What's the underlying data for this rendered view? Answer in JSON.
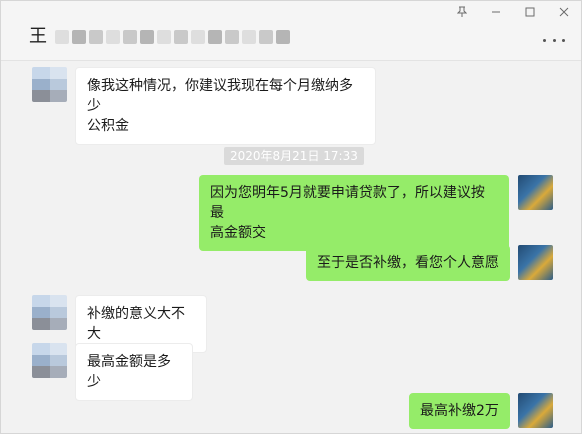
{
  "header": {
    "title_char": "王",
    "window_controls": [
      "pin-icon",
      "minimize-icon",
      "maximize-icon",
      "close-icon"
    ],
    "more_icon": "more-dots-icon"
  },
  "colors": {
    "self_bubble": "#95ec69",
    "other_bubble": "#ffffff",
    "background": "#f2f2f2",
    "timestamp_bg": "#dadada"
  },
  "messages": [
    {
      "from": "other",
      "text": "像我这种情况，你建议我现在每个月缴纳多少\n公积金"
    },
    {
      "type": "timestamp",
      "text": "2020年8月21日 17:33"
    },
    {
      "from": "self",
      "text": "因为您明年5月就要申请贷款了，所以建议按最\n高金额交"
    },
    {
      "from": "self",
      "text": "至于是否补缴，看您个人意愿"
    },
    {
      "from": "other",
      "text": "补缴的意义大不大"
    },
    {
      "from": "other",
      "text": "最高金额是多少"
    },
    {
      "from": "self",
      "text": "最高补缴2万"
    }
  ]
}
